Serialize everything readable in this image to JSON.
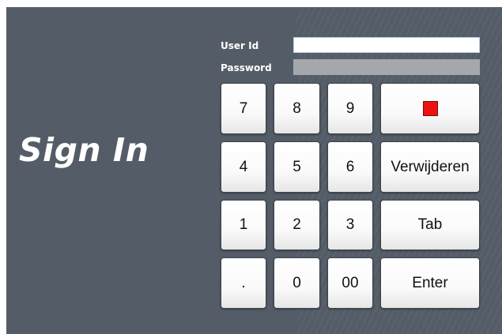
{
  "title": "Sign In",
  "form": {
    "user_id_label": "User Id",
    "user_id_value": "",
    "password_label": "Password",
    "password_value": ""
  },
  "keypad": {
    "k7": "7",
    "k8": "8",
    "k9": "9",
    "stop_icon": "red-square-icon",
    "k4": "4",
    "k5": "5",
    "k6": "6",
    "delete": "Verwijderen",
    "k1": "1",
    "k2": "2",
    "k3": "3",
    "tab": "Tab",
    "dot": ".",
    "k0": "0",
    "k00": "00",
    "enter": "Enter"
  },
  "colors": {
    "background": "#545d67",
    "stop": "#ee1111"
  }
}
